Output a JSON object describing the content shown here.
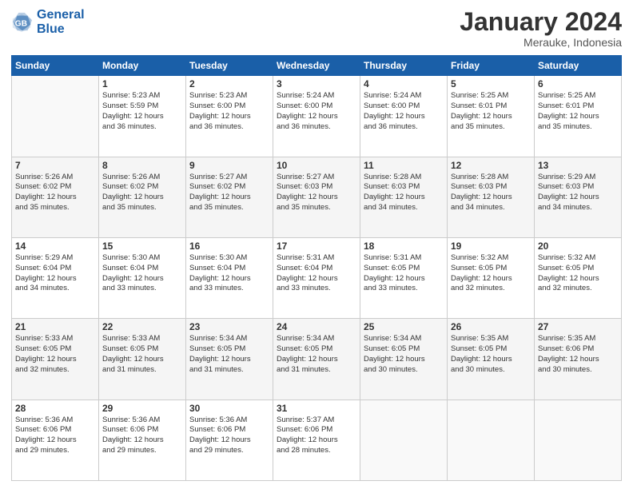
{
  "header": {
    "logo_line1": "General",
    "logo_line2": "Blue",
    "title": "January 2024",
    "subtitle": "Merauke, Indonesia"
  },
  "columns": [
    "Sunday",
    "Monday",
    "Tuesday",
    "Wednesday",
    "Thursday",
    "Friday",
    "Saturday"
  ],
  "weeks": [
    [
      {
        "num": "",
        "info": ""
      },
      {
        "num": "1",
        "info": "Sunrise: 5:23 AM\nSunset: 5:59 PM\nDaylight: 12 hours\nand 36 minutes."
      },
      {
        "num": "2",
        "info": "Sunrise: 5:23 AM\nSunset: 6:00 PM\nDaylight: 12 hours\nand 36 minutes."
      },
      {
        "num": "3",
        "info": "Sunrise: 5:24 AM\nSunset: 6:00 PM\nDaylight: 12 hours\nand 36 minutes."
      },
      {
        "num": "4",
        "info": "Sunrise: 5:24 AM\nSunset: 6:00 PM\nDaylight: 12 hours\nand 36 minutes."
      },
      {
        "num": "5",
        "info": "Sunrise: 5:25 AM\nSunset: 6:01 PM\nDaylight: 12 hours\nand 35 minutes."
      },
      {
        "num": "6",
        "info": "Sunrise: 5:25 AM\nSunset: 6:01 PM\nDaylight: 12 hours\nand 35 minutes."
      }
    ],
    [
      {
        "num": "7",
        "info": "Sunrise: 5:26 AM\nSunset: 6:02 PM\nDaylight: 12 hours\nand 35 minutes."
      },
      {
        "num": "8",
        "info": "Sunrise: 5:26 AM\nSunset: 6:02 PM\nDaylight: 12 hours\nand 35 minutes."
      },
      {
        "num": "9",
        "info": "Sunrise: 5:27 AM\nSunset: 6:02 PM\nDaylight: 12 hours\nand 35 minutes."
      },
      {
        "num": "10",
        "info": "Sunrise: 5:27 AM\nSunset: 6:03 PM\nDaylight: 12 hours\nand 35 minutes."
      },
      {
        "num": "11",
        "info": "Sunrise: 5:28 AM\nSunset: 6:03 PM\nDaylight: 12 hours\nand 34 minutes."
      },
      {
        "num": "12",
        "info": "Sunrise: 5:28 AM\nSunset: 6:03 PM\nDaylight: 12 hours\nand 34 minutes."
      },
      {
        "num": "13",
        "info": "Sunrise: 5:29 AM\nSunset: 6:03 PM\nDaylight: 12 hours\nand 34 minutes."
      }
    ],
    [
      {
        "num": "14",
        "info": "Sunrise: 5:29 AM\nSunset: 6:04 PM\nDaylight: 12 hours\nand 34 minutes."
      },
      {
        "num": "15",
        "info": "Sunrise: 5:30 AM\nSunset: 6:04 PM\nDaylight: 12 hours\nand 33 minutes."
      },
      {
        "num": "16",
        "info": "Sunrise: 5:30 AM\nSunset: 6:04 PM\nDaylight: 12 hours\nand 33 minutes."
      },
      {
        "num": "17",
        "info": "Sunrise: 5:31 AM\nSunset: 6:04 PM\nDaylight: 12 hours\nand 33 minutes."
      },
      {
        "num": "18",
        "info": "Sunrise: 5:31 AM\nSunset: 6:05 PM\nDaylight: 12 hours\nand 33 minutes."
      },
      {
        "num": "19",
        "info": "Sunrise: 5:32 AM\nSunset: 6:05 PM\nDaylight: 12 hours\nand 32 minutes."
      },
      {
        "num": "20",
        "info": "Sunrise: 5:32 AM\nSunset: 6:05 PM\nDaylight: 12 hours\nand 32 minutes."
      }
    ],
    [
      {
        "num": "21",
        "info": "Sunrise: 5:33 AM\nSunset: 6:05 PM\nDaylight: 12 hours\nand 32 minutes."
      },
      {
        "num": "22",
        "info": "Sunrise: 5:33 AM\nSunset: 6:05 PM\nDaylight: 12 hours\nand 31 minutes."
      },
      {
        "num": "23",
        "info": "Sunrise: 5:34 AM\nSunset: 6:05 PM\nDaylight: 12 hours\nand 31 minutes."
      },
      {
        "num": "24",
        "info": "Sunrise: 5:34 AM\nSunset: 6:05 PM\nDaylight: 12 hours\nand 31 minutes."
      },
      {
        "num": "25",
        "info": "Sunrise: 5:34 AM\nSunset: 6:05 PM\nDaylight: 12 hours\nand 30 minutes."
      },
      {
        "num": "26",
        "info": "Sunrise: 5:35 AM\nSunset: 6:05 PM\nDaylight: 12 hours\nand 30 minutes."
      },
      {
        "num": "27",
        "info": "Sunrise: 5:35 AM\nSunset: 6:06 PM\nDaylight: 12 hours\nand 30 minutes."
      }
    ],
    [
      {
        "num": "28",
        "info": "Sunrise: 5:36 AM\nSunset: 6:06 PM\nDaylight: 12 hours\nand 29 minutes."
      },
      {
        "num": "29",
        "info": "Sunrise: 5:36 AM\nSunset: 6:06 PM\nDaylight: 12 hours\nand 29 minutes."
      },
      {
        "num": "30",
        "info": "Sunrise: 5:36 AM\nSunset: 6:06 PM\nDaylight: 12 hours\nand 29 minutes."
      },
      {
        "num": "31",
        "info": "Sunrise: 5:37 AM\nSunset: 6:06 PM\nDaylight: 12 hours\nand 28 minutes."
      },
      {
        "num": "",
        "info": ""
      },
      {
        "num": "",
        "info": ""
      },
      {
        "num": "",
        "info": ""
      }
    ]
  ]
}
